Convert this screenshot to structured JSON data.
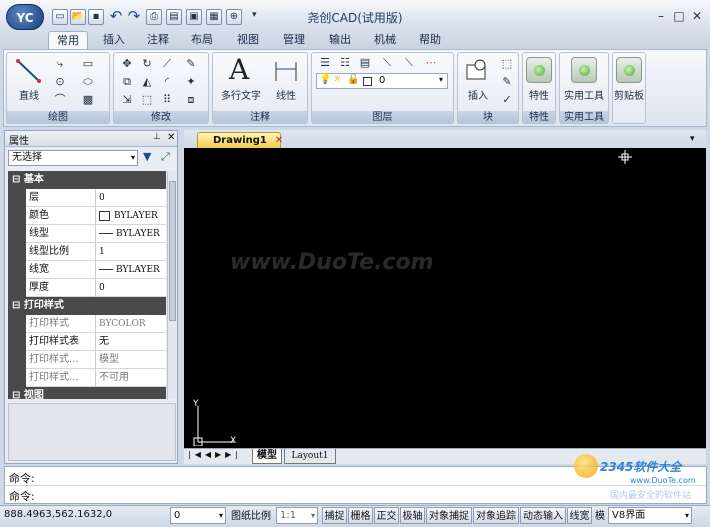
{
  "app": {
    "logo": "YC",
    "title": "尧创CAD(试用版)"
  },
  "quick_access": [
    "new-icon",
    "open-icon",
    "save-icon",
    "undo-icon",
    "redo-icon",
    "print-icon",
    "layout-icon",
    "preview-icon",
    "zoom-icon"
  ],
  "tabs": [
    "常用",
    "插入",
    "注释",
    "布局",
    "视图",
    "管理",
    "输出",
    "机械",
    "帮助"
  ],
  "active_tab": "常用",
  "ribbon": {
    "draw": {
      "big_label": "直线",
      "group_label": "绘图"
    },
    "modify": {
      "group_label": "修改"
    },
    "annotate": {
      "text_label": "多行文字",
      "linear_label": "线性",
      "group_label": "注释"
    },
    "layers": {
      "layer_value": "0",
      "group_label": "图层"
    },
    "block": {
      "insert_label": "插入",
      "group_label": "块"
    },
    "properties": {
      "label": "特性",
      "group_label": "特性"
    },
    "utilities": {
      "label": "实用工具",
      "group_label": "实用工具"
    },
    "clipboard": {
      "label": "剪贴板"
    }
  },
  "properties_panel": {
    "title": "属性",
    "selection": "无选择",
    "categories": {
      "basic": "基本",
      "print": "打印样式",
      "view": "视图"
    },
    "basic_rows": [
      {
        "name": "层",
        "value": "0"
      },
      {
        "name": "颜色",
        "value": "BYLAYER"
      },
      {
        "name": "线型",
        "value": "BYLAYER"
      },
      {
        "name": "线型比例",
        "value": "1"
      },
      {
        "name": "线宽",
        "value": "BYLAYER"
      },
      {
        "name": "厚度",
        "value": "0"
      }
    ],
    "print_rows": [
      {
        "name": "打印样式",
        "value": "BYCOLOR"
      },
      {
        "name": "打印样式表",
        "value": "无"
      },
      {
        "name": "打印样式...",
        "value": "模型"
      },
      {
        "name": "打印样式...",
        "value": "不可用"
      }
    ]
  },
  "document_tab": "Drawing1",
  "watermark": "www.DuoTe.com",
  "layout_tabs": [
    "模型",
    "Layout1"
  ],
  "command_lines": [
    "命令:",
    "命令:"
  ],
  "status_bar": {
    "coords": "888.4963,562.1632,0",
    "layer_value": "0",
    "scale_label": "图纸比例",
    "scale_value": "1:1",
    "toggles": [
      "捕捉",
      "栅格",
      "正交",
      "极轴",
      "对象捕捉",
      "对象追踪",
      "动态输入",
      "线宽",
      "模"
    ],
    "v8": "V8界面"
  },
  "corner_logo": {
    "brand": "2345软件大全",
    "url": "www.DuoTe.com",
    "caption": "国内最安全的软件站"
  }
}
